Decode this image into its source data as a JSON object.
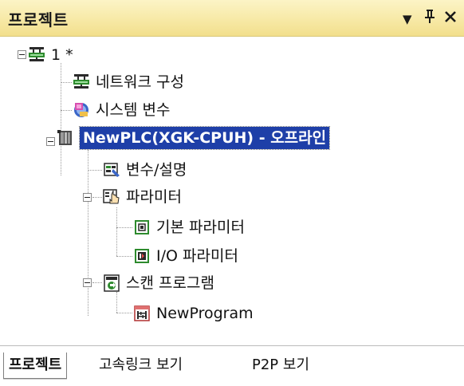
{
  "panel": {
    "title": "프로젝트",
    "controls": {
      "dropdown_glyph": "▼",
      "pin_glyph": "ᅮ",
      "close_glyph": "✕"
    }
  },
  "tree": {
    "project": {
      "label": "1 *",
      "icon": "network-config-icon"
    },
    "network": {
      "label": "네트워크 구성",
      "icon": "network-config-icon"
    },
    "system_vars": {
      "label": "시스템 변수",
      "icon": "system-variable-icon"
    },
    "plc": {
      "label": "NewPLC(XGK-CPUH) - 오프라인",
      "icon": "plc-cpu-icon",
      "selected": true
    },
    "var_desc": {
      "label": "변수/설명",
      "icon": "variable-comment-icon"
    },
    "params": {
      "label": "파라미터",
      "icon": "parameter-hand-icon"
    },
    "basic_params": {
      "label": "기본 파라미터",
      "icon": "basic-parameter-icon"
    },
    "io_params": {
      "label": "I/O 파라미터",
      "icon": "io-parameter-icon"
    },
    "scan": {
      "label": "스캔 프로그램",
      "icon": "scan-program-icon"
    },
    "program": {
      "label": "NewProgram",
      "icon": "ladder-program-icon"
    }
  },
  "tabs": [
    {
      "label": "프로젝트",
      "active": true
    },
    {
      "label": "고속링크 보기",
      "active": false
    },
    {
      "label": "P2P 보기",
      "active": false
    }
  ],
  "colors": {
    "title_bar": "#f7e9a6",
    "selection": "#1e3fa8",
    "icon_green": "#2e8b2e",
    "icon_dark": "#2a2a2a"
  }
}
